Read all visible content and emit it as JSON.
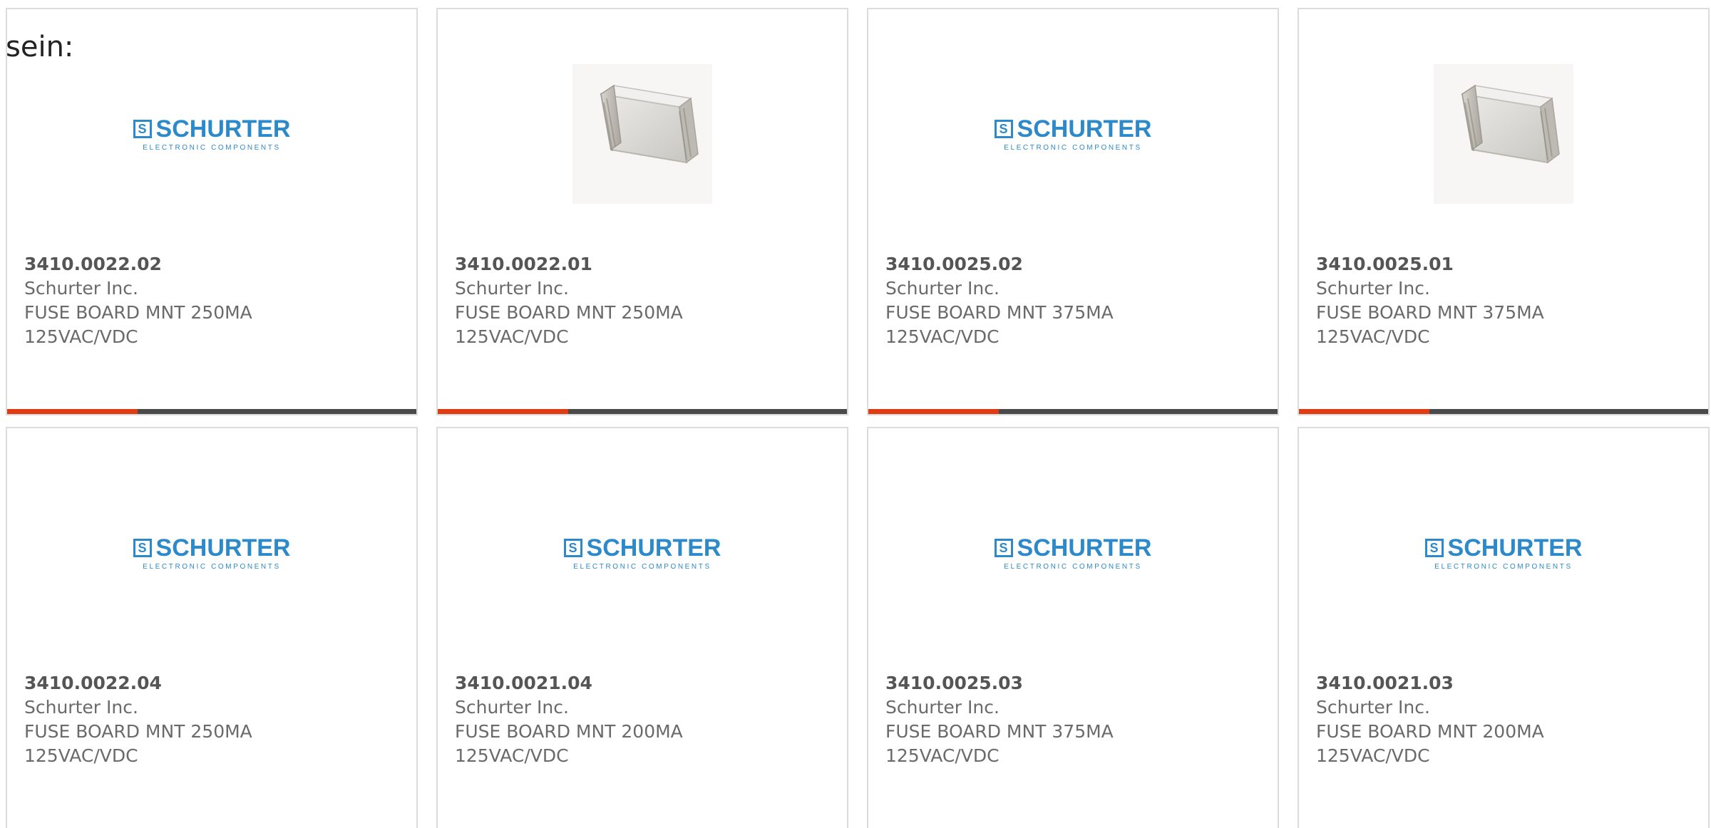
{
  "intro_text": "sein:",
  "colors": {
    "accent_bar": "#e03b12",
    "bar": "#4a4a4a",
    "logo_blue": "#2c8acb"
  },
  "logo": {
    "mark": "S",
    "name": "SCHURTER",
    "tagline": "ELECTRONIC COMPONENTS"
  },
  "cards": [
    {
      "part_number": "3410.0022.02",
      "manufacturer": "Schurter Inc.",
      "desc_line1": "FUSE BOARD MNT 250MA",
      "desc_line2": "125VAC/VDC",
      "image": "schurter-logo"
    },
    {
      "part_number": "3410.0022.01",
      "manufacturer": "Schurter Inc.",
      "desc_line1": "FUSE BOARD MNT 250MA",
      "desc_line2": "125VAC/VDC",
      "image": "fuse-photo"
    },
    {
      "part_number": "3410.0025.02",
      "manufacturer": "Schurter Inc.",
      "desc_line1": "FUSE BOARD MNT 375MA",
      "desc_line2": "125VAC/VDC",
      "image": "schurter-logo"
    },
    {
      "part_number": "3410.0025.01",
      "manufacturer": "Schurter Inc.",
      "desc_line1": "FUSE BOARD MNT 375MA",
      "desc_line2": "125VAC/VDC",
      "image": "fuse-photo"
    },
    {
      "part_number": "3410.0022.04",
      "manufacturer": "Schurter Inc.",
      "desc_line1": "FUSE BOARD MNT 250MA",
      "desc_line2": "125VAC/VDC",
      "image": "schurter-logo"
    },
    {
      "part_number": "3410.0021.04",
      "manufacturer": "Schurter Inc.",
      "desc_line1": "FUSE BOARD MNT 200MA",
      "desc_line2": "125VAC/VDC",
      "image": "schurter-logo"
    },
    {
      "part_number": "3410.0025.03",
      "manufacturer": "Schurter Inc.",
      "desc_line1": "FUSE BOARD MNT 375MA",
      "desc_line2": "125VAC/VDC",
      "image": "schurter-logo"
    },
    {
      "part_number": "3410.0021.03",
      "manufacturer": "Schurter Inc.",
      "desc_line1": "FUSE BOARD MNT 200MA",
      "desc_line2": "125VAC/VDC",
      "image": "schurter-logo"
    }
  ]
}
